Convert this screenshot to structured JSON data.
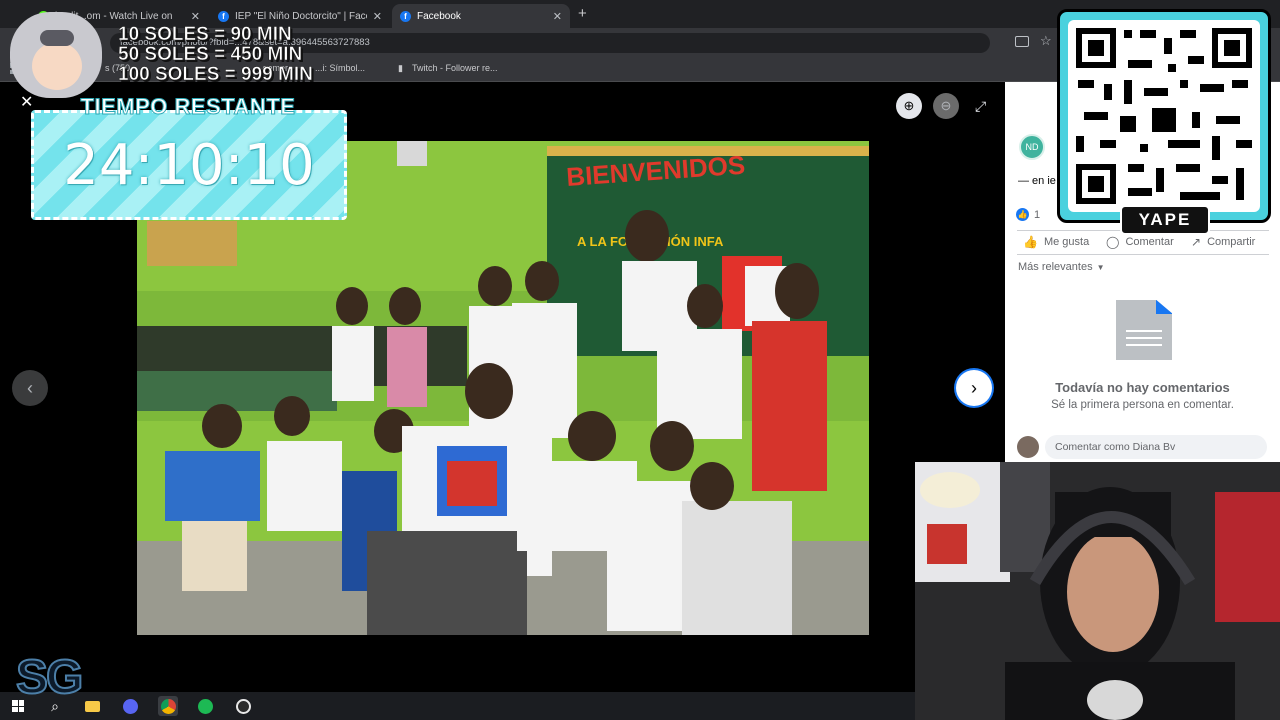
{
  "browser": {
    "tabs": [
      {
        "title": "koalit...om - Watch Live on",
        "fav": "K",
        "color": "#53fc18"
      },
      {
        "title": "IEP \"El Niño Doctorcito\" | Faceb",
        "fav": "f",
        "color": "#1877f2"
      },
      {
        "title": "Facebook",
        "fav": "f",
        "color": "#1877f2"
      }
    ],
    "new_tab": "+",
    "close_glyph": "✕",
    "url": "facebook.com/photo/?fbid=...478&set=a.396445563727883",
    "bookmarks": [
      "s (750...",
      "...eamer...",
      "...i: Símbol...",
      "Twitch - Follower re..."
    ]
  },
  "viewer": {
    "close": "✕",
    "prev": "‹",
    "next": "›",
    "zoom_in": "⊕",
    "zoom_out": "⊖",
    "fullscreen": "⤢",
    "photo": {
      "banner_text": "BIENVENIDOS",
      "sub_banner": "A LA FORMACIÓN INFA"
    }
  },
  "panel": {
    "post_text": "— en ie",
    "reaction_count": "1",
    "actions": [
      "Me gusta",
      "Comentar",
      "Compartir"
    ],
    "sort": "Más relevantes",
    "empty_title": "Todavía no hay comentarios",
    "empty_subtitle": "Sé la primera persona en comentar.",
    "comment_placeholder": "Comentar como Diana Bv"
  },
  "overlay": {
    "prices": [
      "10 SOLES = 90 MIN",
      "50 SOLES = 450 MIN",
      "100 SOLES = 999 MIN"
    ],
    "timer_label": "TIEMPO RESTANTE",
    "timer_value": "24:10:10",
    "payment": "YAPE",
    "corner_logo": "SG"
  },
  "colors": {
    "fb_blue": "#1877f2",
    "cyan": "#74e3ec",
    "chrome_dark": "#202124"
  },
  "icons": [
    "windows-icon",
    "search-icon",
    "folder-icon",
    "discord-icon",
    "chrome-icon",
    "spotify-icon",
    "obs-icon"
  ]
}
